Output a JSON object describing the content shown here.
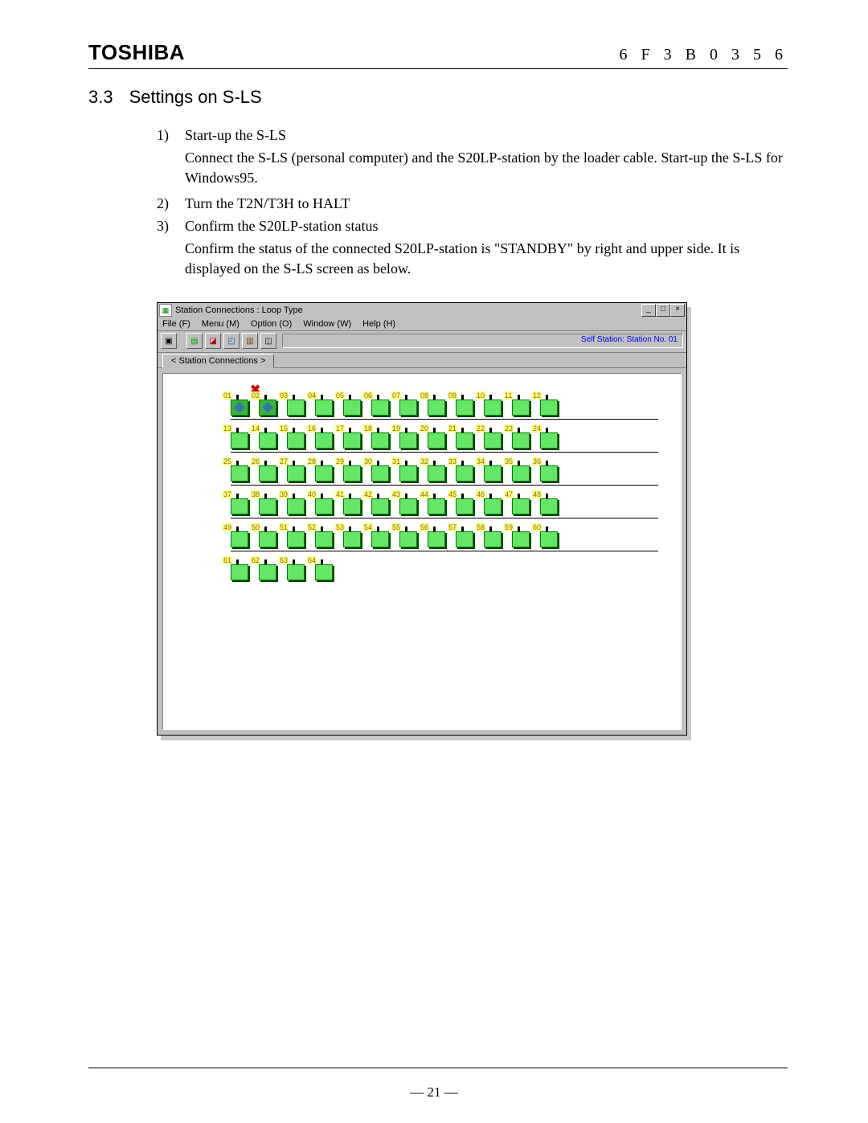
{
  "header": {
    "brand": "TOSHIBA",
    "code": "6 F 3 B 0 3 5 6"
  },
  "section": {
    "num": "3.3",
    "title": "Settings on S-LS"
  },
  "items": [
    {
      "num": "1)",
      "title": "Start-up the S-LS",
      "body": "Connect the S-LS (personal computer) and the S20LP-station by the loader cable. Start-up the S-LS for Windows95."
    },
    {
      "num": "2)",
      "title": "Turn the T2N/T3H to HALT",
      "body": ""
    },
    {
      "num": "3)",
      "title": "Confirm the S20LP-station status",
      "body": "Confirm the status of the connected S20LP-station is \"STANDBY\" by right and upper side. It is displayed on the S-LS screen as below."
    }
  ],
  "window": {
    "title": "Station Connections : Loop Type",
    "menu": [
      "File (F)",
      "Menu (M)",
      "Option (O)",
      "Window (W)",
      "Help (H)"
    ],
    "status_label": "Self Station: Station No. 01",
    "tab": "< Station Connections >",
    "station_count": 64,
    "rows": [
      [
        1,
        2,
        3,
        4,
        5,
        6,
        7,
        8,
        9,
        10,
        11,
        12
      ],
      [
        13,
        14,
        15,
        16,
        17,
        18,
        19,
        20,
        21,
        22,
        23,
        24
      ],
      [
        25,
        26,
        27,
        28,
        29,
        30,
        31,
        32,
        33,
        34,
        35,
        36
      ],
      [
        37,
        38,
        39,
        40,
        41,
        42,
        43,
        44,
        45,
        46,
        47,
        48
      ],
      [
        49,
        50,
        51,
        52,
        53,
        54,
        55,
        56,
        57,
        58,
        59,
        60
      ],
      [
        61,
        62,
        63,
        64
      ]
    ],
    "special_stations": [
      1,
      2
    ]
  },
  "page_number": "— 21 —"
}
